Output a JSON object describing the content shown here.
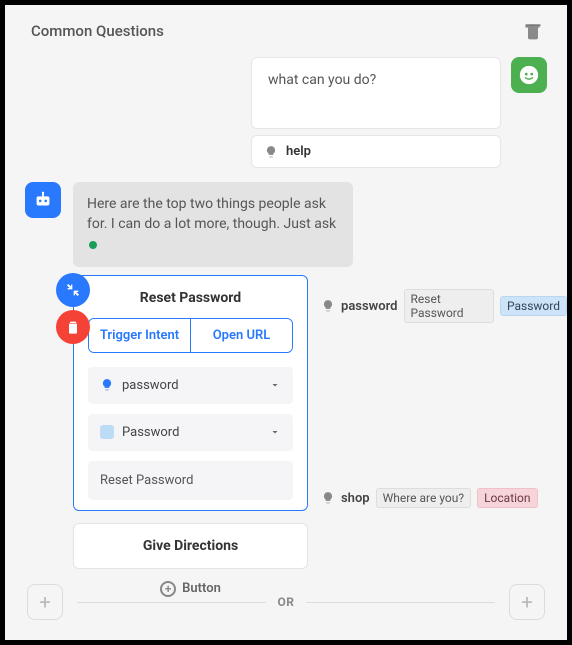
{
  "header": {
    "title": "Common Questions"
  },
  "user_message": "what can you do?",
  "help_chip": "help",
  "bot_message": "Here are the top two things people ask for. I can do a lot more, though. Just ask",
  "card": {
    "title": "Reset Password",
    "tabs": {
      "trigger": "Trigger Intent",
      "open_url": "Open URL"
    },
    "field_intent": "password",
    "field_entity": "Password",
    "field_display": "Reset Password"
  },
  "annot1": {
    "intent": "password",
    "badges": [
      "Reset Password",
      "Password"
    ]
  },
  "give_directions_label": "Give Directions",
  "annot2": {
    "intent": "shop",
    "badges": [
      "Where are you?",
      "Location"
    ]
  },
  "add_button_label": "Button",
  "or_label": "OR"
}
